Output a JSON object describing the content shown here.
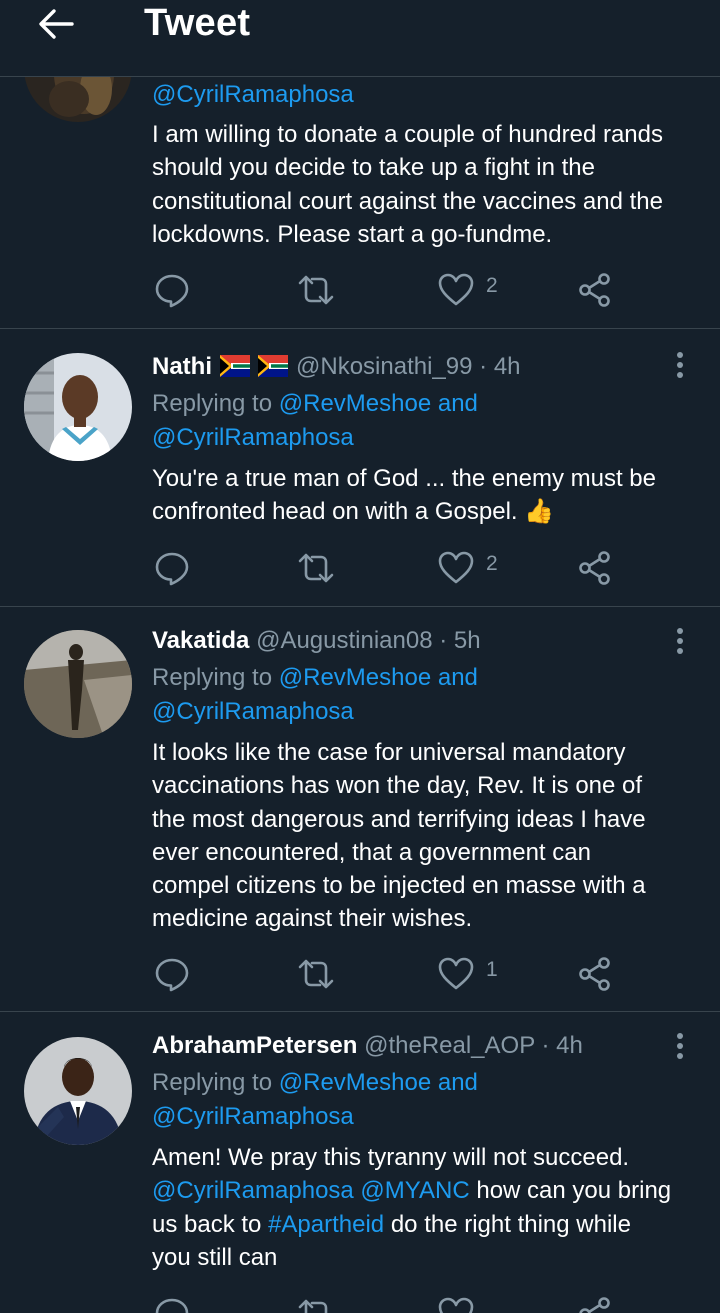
{
  "header": {
    "title": "Tweet"
  },
  "tweets": [
    {
      "mention": "@CyrilRamaphosa",
      "body": [
        "I am willing to donate a couple of hundred rands",
        "should you decide to take up a fight in the",
        "constitutional court against the vaccines and the",
        "lockdowns. Please start a go-fundme."
      ],
      "like_count": "2"
    },
    {
      "name": "Nathi",
      "handle": "@Nkosinathi_99",
      "time": "4h",
      "replying_prefix": "Replying to",
      "replying_link": "@RevMeshoe and",
      "replying_mention": "@CyrilRamaphosa",
      "body": [
        "You're a true man of God ... the enemy must be",
        "confronted head on with a Gospel. 👍"
      ],
      "like_count": "2"
    },
    {
      "name": "Vakatida",
      "handle": "@Augustinian08",
      "time": "5h",
      "replying_prefix": "Replying to",
      "replying_link": "@RevMeshoe and",
      "replying_mention": "@CyrilRamaphosa",
      "body": [
        "It looks like the case for universal mandatory",
        "vaccinations has won the day, Rev. It is one of",
        "the most dangerous and terrifying ideas I have",
        "ever encountered, that a government can",
        "compel citizens to be injected en masse with a",
        "medicine against their wishes."
      ],
      "like_count": "1"
    },
    {
      "name": "AbrahamPetersen",
      "handle": "@theReal_AOP",
      "time": "4h",
      "replying_prefix": "Replying to",
      "replying_link": "@RevMeshoe and",
      "replying_mention": "@CyrilRamaphosa",
      "body_line1": "Amen! We pray this tyranny will not succeed.",
      "body_line2_mentions": "@CyrilRamaphosa @MYANC",
      "body_line2_text": " how can you bring",
      "body_line3_text": "us back to ",
      "body_line3_hashtag": "#Apartheid",
      "body_line3_rest": " do the right thing while",
      "body_line4_text": "you still can"
    }
  ],
  "separator_dot": "·",
  "colors": {
    "background": "#15202b",
    "link": "#1d9bf0",
    "muted": "#8899a6",
    "divider": "#38444d"
  },
  "icons": [
    "back-arrow-icon",
    "reply-icon",
    "retweet-icon",
    "like-icon",
    "share-icon",
    "more-icon",
    "south-africa-flag-icon",
    "thumbs-up-emoji"
  ]
}
